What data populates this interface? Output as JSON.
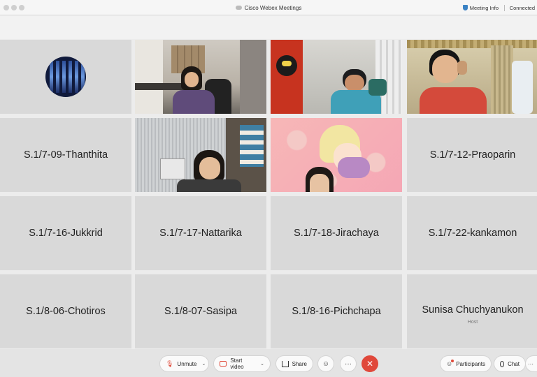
{
  "window": {
    "title": "Cisco Webex Meetings",
    "meeting_info_label": "Meeting Info",
    "status": "Connected"
  },
  "grid": {
    "row2": [
      "S.1/7-09-Thanthita",
      "S.1/7-12-Praoparin"
    ],
    "row3": [
      "S.1/7-16-Jukkrid",
      "S.1/7-17-Nattarika",
      "S.1/7-18-Jirachaya",
      "S.1/7-22-kankamon"
    ],
    "row4": [
      "S.1/8-06-Chotiros",
      "S.1/8-07-Sasipa",
      "S.1/8-16-Pichchapa",
      "Sunisa Chuchyanukon"
    ],
    "host_label": "Host"
  },
  "toolbar": {
    "unmute_label": "Unmute",
    "start_video_label": "Start video",
    "share_label": "Share",
    "more_symbol": "···",
    "end_symbol": "✕",
    "participants_label": "Participants",
    "chat_label": "Chat"
  },
  "icons": {
    "mic": "microphone-muted-icon",
    "video": "video-off-icon",
    "share": "share-icon",
    "reactions": "smiley-icon",
    "more": "more-dots-icon",
    "end": "close-icon",
    "participants": "people-icon",
    "chat": "chat-bubble-icon"
  },
  "colors": {
    "end_call": "#e0483b",
    "muted_accent": "#e04a3a",
    "tile_bg": "#d9d9d9"
  }
}
